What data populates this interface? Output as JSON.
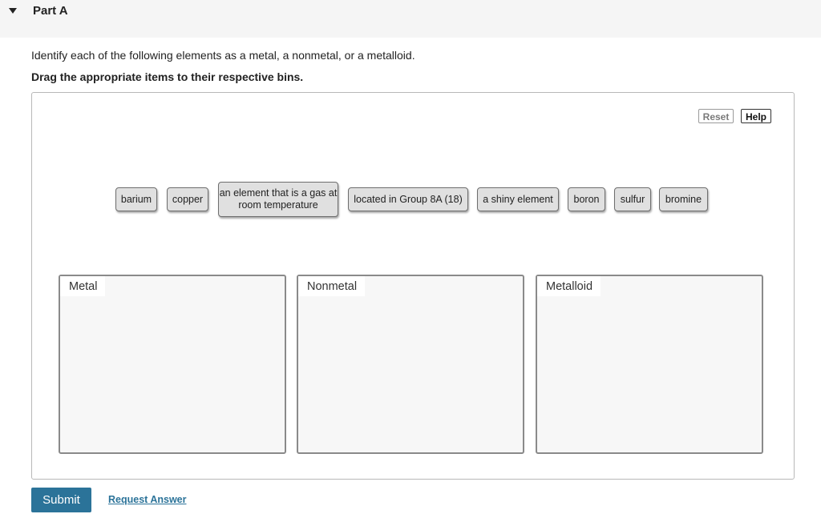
{
  "part": {
    "title": "Part A",
    "toggle_icon": "caret-down-icon"
  },
  "question": {
    "instruction": "Identify each of the following elements as a metal, a nonmetal, or a metalloid.",
    "drag_instruction": "Drag the appropriate items to their respective bins."
  },
  "toolbar": {
    "reset_label": "Reset",
    "help_label": "Help"
  },
  "items": [
    "barium",
    "copper",
    "an element that is a gas at room temperature",
    "located in Group 8A (18)",
    "a shiny element",
    "boron",
    "sulfur",
    "bromine"
  ],
  "bins": [
    "Metal",
    "Nonmetal",
    "Metalloid"
  ],
  "actions": {
    "submit_label": "Submit",
    "request_answer_label": "Request Answer"
  },
  "colors": {
    "accent": "#2b7399",
    "chip_background": "#e0e0e0",
    "bin_background": "#f7f7f7"
  }
}
